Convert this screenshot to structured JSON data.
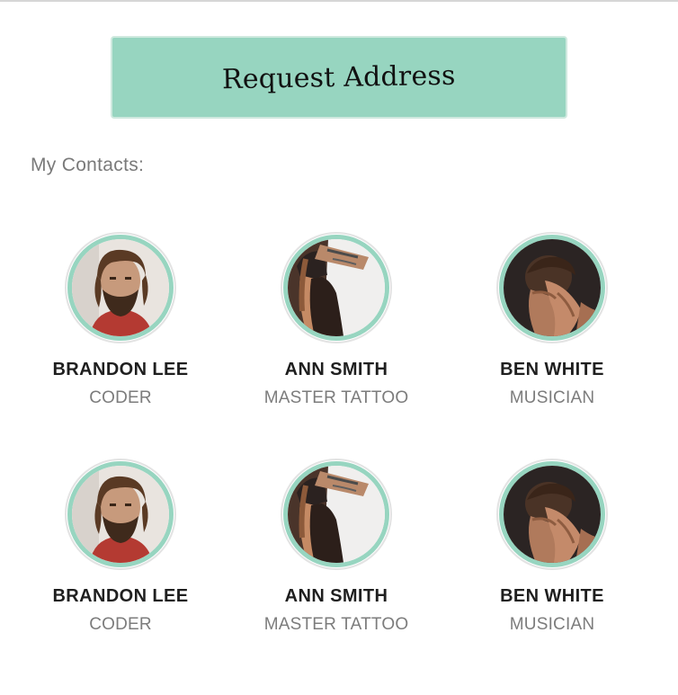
{
  "request_button": {
    "label": "Request Address"
  },
  "contacts_section": {
    "title": "My Contacts:"
  },
  "colors": {
    "accent": "#97d5c0",
    "name": "#1f1f1f",
    "role": "#7c7c7c"
  },
  "contacts": [
    {
      "name": "BRANDON LEE",
      "role": "CODER",
      "avatar": "bearded-man-photo"
    },
    {
      "name": "ANN SMITH",
      "role": "MASTER TATTOO",
      "avatar": "tattooed-woman-photo"
    },
    {
      "name": "BEN WHITE",
      "role": "MUSICIAN",
      "avatar": "man-face-in-hands-photo"
    },
    {
      "name": "BRANDON LEE",
      "role": "CODER",
      "avatar": "bearded-man-photo"
    },
    {
      "name": "ANN SMITH",
      "role": "MASTER TATTOO",
      "avatar": "tattooed-woman-photo"
    },
    {
      "name": "BEN WHITE",
      "role": "MUSICIAN",
      "avatar": "man-face-in-hands-photo"
    }
  ]
}
